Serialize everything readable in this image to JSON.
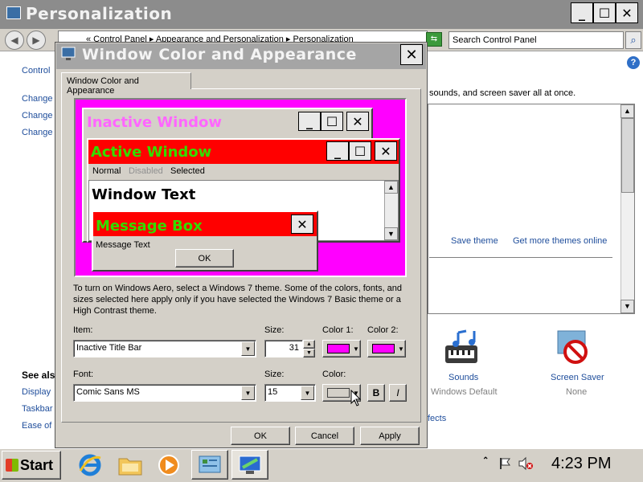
{
  "window": {
    "title": "Personalization",
    "buttons": {
      "minimize": "_",
      "maximize": "☐",
      "close": "✕"
    }
  },
  "nav": {
    "address": "« Control Panel  ▸  Appearance and Personalization  ▸  Personalization",
    "search_placeholder": "Search Control Panel"
  },
  "sidebar": {
    "links": [
      "Control",
      "Change",
      "Change",
      "Change"
    ],
    "see_also": "See als",
    "see_also_links": [
      "Display",
      "Taskbar",
      "Ease of"
    ]
  },
  "main": {
    "intro_fragment": "sounds, and screen saver all at once.",
    "save_theme": "Save theme",
    "get_more_themes": "Get more themes online",
    "effects_fragment": "fects",
    "sounds": {
      "label": "Sounds",
      "value": "Windows Default"
    },
    "screensaver": {
      "label": "Screen Saver",
      "value": "None"
    },
    "help_glyph": "?"
  },
  "dialog": {
    "title": "Window Color and Appearance",
    "tab": "Window Color and Appearance",
    "preview": {
      "inactive_title": "Inactive Window",
      "active_title": "Active Window",
      "menu": {
        "normal": "Normal",
        "disabled": "Disabled",
        "selected": "Selected"
      },
      "window_text": "Window Text",
      "message_title": "Message Box",
      "message_text": "Message Text",
      "ok": "OK"
    },
    "info": "To turn on Windows Aero, select a Windows 7 theme.  Some of the colors, fonts, and sizes selected here apply only if you have selected the Windows 7 Basic theme or a High Contrast theme.",
    "item_label": "Item:",
    "item_value": "Inactive Title Bar",
    "size_label": "Size:",
    "size_value": "31",
    "color1_label": "Color 1:",
    "color2_label": "Color 2:",
    "font_label": "Font:",
    "font_value": "Comic Sans MS",
    "font_size_label": "Size:",
    "font_size_value": "15",
    "font_color_label": "Color:",
    "bold": "B",
    "italic": "I",
    "ok": "OK",
    "cancel": "Cancel",
    "apply": "Apply"
  },
  "colors": {
    "swatch_color1": "#ff00ff",
    "swatch_color2": "#ff00ff",
    "active_title_bg": "#ff0000",
    "active_title_text": "#00cc00",
    "inactive_title_text": "#ff66ff"
  },
  "taskbar": {
    "start": "Start",
    "clock": "4:23 PM",
    "icons": [
      "internet-explorer-icon",
      "folder-icon",
      "media-player-icon",
      "control-panel-icon",
      "personalization-icon"
    ]
  }
}
